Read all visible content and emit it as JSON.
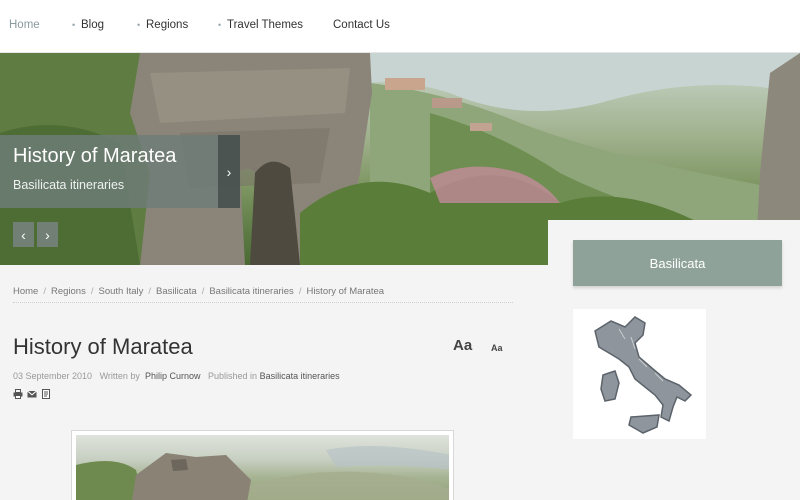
{
  "nav": {
    "items": [
      {
        "label": "Home",
        "active": true
      },
      {
        "label": "Blog",
        "active": false
      },
      {
        "label": "Regions",
        "active": false
      },
      {
        "label": "Travel Themes",
        "active": false
      },
      {
        "label": "Contact Us",
        "active": false
      }
    ]
  },
  "slide": {
    "title": "History of Maratea",
    "subtitle": "Basilicata itineraries"
  },
  "breadcrumb": [
    "Home",
    "Regions",
    "South Italy",
    "Basilicata",
    "Basilicata itineraries",
    "History of Maratea"
  ],
  "article": {
    "title": "History of Maratea",
    "font_large": "Aa",
    "font_small": "Aa",
    "date": "03 September 2010",
    "written_by_label": "Written by",
    "author": "Philip Curnow",
    "published_label": "Published in",
    "category": "Basilicata itineraries",
    "tool_icons": [
      "print-icon",
      "email-icon",
      "pdf-icon"
    ]
  },
  "sidebar": {
    "module_title": "Basilicata",
    "map_icon": "italy-map"
  },
  "colors": {
    "accent": "#8fa29a",
    "slide_overlay": "#6e7d78",
    "nav_active": "#8a9aa0"
  }
}
